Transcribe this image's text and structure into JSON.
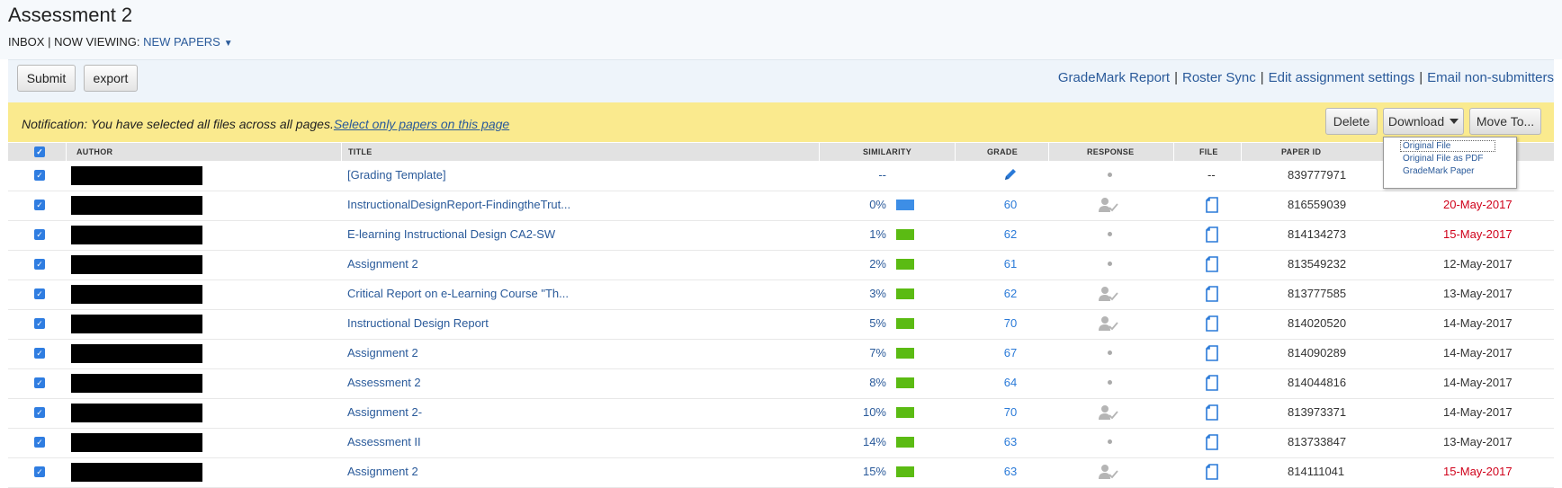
{
  "header": {
    "title": "Assessment 2",
    "inbox": "INBOX",
    "sep": "|",
    "now_viewing_label": "NOW VIEWING:",
    "now_viewing_value": "NEW PAPERS",
    "caret": "▼"
  },
  "toolbar": {
    "submit_label": "Submit",
    "export_label": "export",
    "links": [
      "GradeMark Report",
      "Roster Sync",
      "Edit assignment settings",
      "Email non-submitters"
    ],
    "sep": "|"
  },
  "notification": {
    "text": "Notification: You have selected all files across all pages.",
    "link": "Select only papers on this page"
  },
  "actions": {
    "delete_label": "Delete",
    "download_label": "Download",
    "move_label": "Move To..."
  },
  "download_menu": [
    "Original File",
    "Original File as PDF",
    "GradeMark Paper"
  ],
  "columns": {
    "author": "AUTHOR",
    "title": "TITLE",
    "similarity": "SIMILARITY",
    "grade": "GRADE",
    "response": "RESPONSE",
    "file": "FILE",
    "paper_id": "PAPER ID"
  },
  "colors": {
    "similarity_blue": "#3d8ee6",
    "similarity_green": "#5bbb13",
    "late_date": "#d0021b",
    "notification_bg": "#faea8e"
  },
  "rows": [
    {
      "title": "[Grading Template]",
      "similarity": "--",
      "bar": null,
      "grade": "",
      "grade_icon": "pencil-icon",
      "response": "dot",
      "file": "--",
      "paper_id": "839777971",
      "date": "",
      "late": false
    },
    {
      "title": "InstructionalDesignReport-FindingtheTrut...",
      "similarity": "0%",
      "bar": "blue",
      "grade": "60",
      "response": "person",
      "file": "doc",
      "paper_id": "816559039",
      "date": "20-May-2017",
      "late": true
    },
    {
      "title": "E-learning Instructional Design CA2-SW",
      "similarity": "1%",
      "bar": "green",
      "grade": "62",
      "response": "dot",
      "file": "doc",
      "paper_id": "814134273",
      "date": "15-May-2017",
      "late": true
    },
    {
      "title": " Assignment 2",
      "similarity": "2%",
      "bar": "green",
      "grade": "61",
      "response": "dot",
      "file": "doc",
      "paper_id": "813549232",
      "date": "12-May-2017",
      "late": false
    },
    {
      "title": "Critical Report on e-Learning Course \"Th...",
      "similarity": "3%",
      "bar": "green",
      "grade": "62",
      "response": "person",
      "file": "doc",
      "paper_id": "813777585",
      "date": "13-May-2017",
      "late": false
    },
    {
      "title": "Instructional Design Report",
      "similarity": "5%",
      "bar": "green",
      "grade": "70",
      "response": "person",
      "file": "doc",
      "paper_id": "814020520",
      "date": "14-May-2017",
      "late": false
    },
    {
      "title": " Assignment 2",
      "similarity": "7%",
      "bar": "green",
      "grade": "67",
      "response": "dot",
      "file": "doc",
      "paper_id": "814090289",
      "date": "14-May-2017",
      "late": false
    },
    {
      "title": "Assessment 2",
      "similarity": "8%",
      "bar": "green",
      "grade": "64",
      "response": "dot",
      "file": "doc",
      "paper_id": "814044816",
      "date": "14-May-2017",
      "late": false
    },
    {
      "title": "Assignment 2-",
      "similarity": "10%",
      "bar": "green",
      "grade": "70",
      "response": "person",
      "file": "doc",
      "paper_id": "813973371",
      "date": "14-May-2017",
      "late": false
    },
    {
      "title": "Assessment II",
      "similarity": "14%",
      "bar": "green",
      "grade": "63",
      "response": "dot",
      "file": "doc",
      "paper_id": "813733847",
      "date": "13-May-2017",
      "late": false
    },
    {
      "title": "Assignment 2",
      "similarity": "15%",
      "bar": "green",
      "grade": "63",
      "response": "person",
      "file": "doc",
      "paper_id": "814111041",
      "date": "15-May-2017",
      "late": true
    }
  ]
}
